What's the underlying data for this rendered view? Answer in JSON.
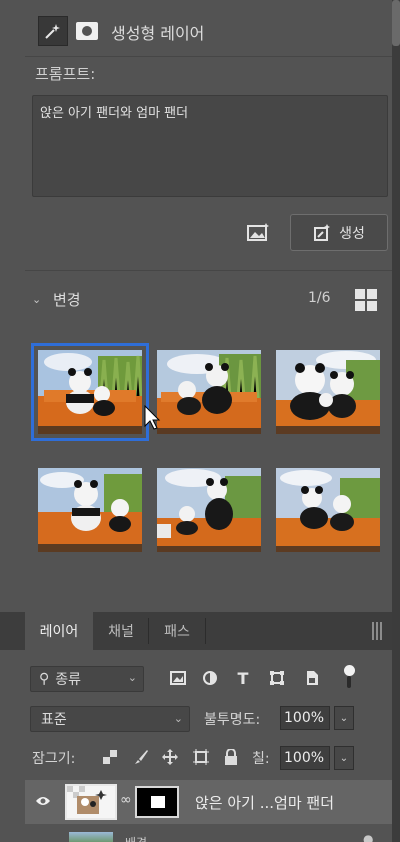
{
  "properties": {
    "layer_kind": "생성형 레이어",
    "prompt_label": "프롬프트:",
    "prompt_text": "앉은 아기 팬더와 엄마 팬더",
    "generate_label": "생성"
  },
  "variations": {
    "title": "변경",
    "count": "1/6",
    "selected_index": 0,
    "thumbnails": [
      {
        "name": "variation-1"
      },
      {
        "name": "variation-2"
      },
      {
        "name": "variation-3"
      },
      {
        "name": "variation-4"
      },
      {
        "name": "variation-5"
      },
      {
        "name": "variation-6"
      }
    ]
  },
  "layers_panel": {
    "tabs": [
      {
        "label": "레이어",
        "active": true
      },
      {
        "label": "채널",
        "active": false
      },
      {
        "label": "패스",
        "active": false
      }
    ],
    "filter_label": "종류",
    "blend_mode": "표준",
    "opacity_label": "불투명도:",
    "opacity_value": "100%",
    "lock_label": "잠그기:",
    "fill_label": "칠:",
    "fill_value": "100%",
    "layers": [
      {
        "name": "앉은 아기 ...엄마 팬더",
        "visible": true,
        "selected": true
      },
      {
        "name": "배경",
        "locked": true
      }
    ]
  },
  "colors": {
    "panel_bg": "#535353",
    "selection": "#2f6ed8",
    "sofa": "#d66a1c"
  }
}
